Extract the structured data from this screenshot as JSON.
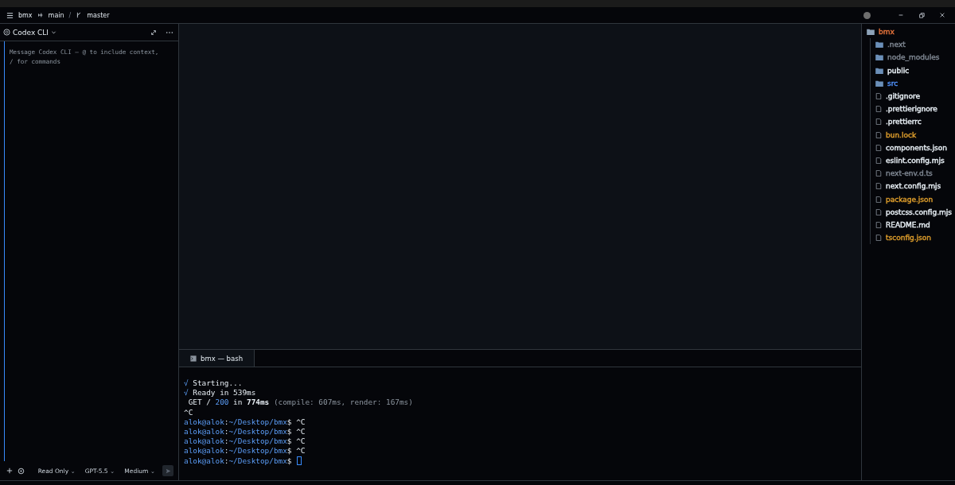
{
  "titlebar": {
    "project": "bmx",
    "branch": "main",
    "separator": "/",
    "vcs_branch": "master"
  },
  "agent_panel": {
    "title": "Codex CLI",
    "placeholder": "Message Codex CLI — @ to include context,\n/ for commands",
    "dropdowns": [
      {
        "label": "Read Only",
        "caret": "⌄"
      },
      {
        "label": "GPT-5.5",
        "caret": "⌄"
      },
      {
        "label": "Medium",
        "caret": "⌄"
      }
    ]
  },
  "terminal": {
    "tab": "bmx — bash",
    "lines": [
      {
        "kind": "status",
        "mark": "√",
        "text": "Starting..."
      },
      {
        "kind": "status",
        "mark": "√",
        "text": "Ready in 539ms"
      },
      {
        "kind": "request",
        "method": "GET /",
        "code": "200",
        "word": "in",
        "duration": "774ms",
        "detail": "(compile: 607ms, render: 167ms)"
      },
      {
        "kind": "plain",
        "text": "^C"
      },
      {
        "kind": "prompt",
        "user": "alok@alok",
        "separator": ":",
        "path": "~/Desktop/bmx",
        "sign": "$",
        "command": "^C",
        "cursor": false
      },
      {
        "kind": "prompt",
        "user": "alok@alok",
        "separator": ":",
        "path": "~/Desktop/bmx",
        "sign": "$",
        "command": "^C",
        "cursor": false
      },
      {
        "kind": "prompt",
        "user": "alok@alok",
        "separator": ":",
        "path": "~/Desktop/bmx",
        "sign": "$",
        "command": "^C",
        "cursor": false
      },
      {
        "kind": "prompt",
        "user": "alok@alok",
        "separator": ":",
        "path": "~/Desktop/bmx",
        "sign": "$",
        "command": "^C",
        "cursor": false
      },
      {
        "kind": "prompt",
        "user": "alok@alok",
        "separator": ":",
        "path": "~/Desktop/bmx",
        "sign": "$",
        "cursor": true
      }
    ]
  },
  "explorer": {
    "root": {
      "name": "bmx",
      "kind": "folder",
      "color": "#e0703a",
      "children": [
        {
          "name": ".next",
          "kind": "folder",
          "color": "#7d8590"
        },
        {
          "name": "node_modules",
          "kind": "folder",
          "color": "#7d8590"
        },
        {
          "name": "public",
          "kind": "folder",
          "color": "#e6edf3"
        },
        {
          "name": "src",
          "kind": "folder",
          "color": "#4f8ff7"
        },
        {
          "name": ".gitignore",
          "kind": "file",
          "color": "#e6edf3"
        },
        {
          "name": ".prettierignore",
          "kind": "file",
          "color": "#e6edf3"
        },
        {
          "name": ".prettierrc",
          "kind": "file",
          "color": "#e6edf3"
        },
        {
          "name": "bun.lock",
          "kind": "file",
          "color": "#d99a2b"
        },
        {
          "name": "components.json",
          "kind": "file",
          "color": "#e6edf3"
        },
        {
          "name": "eslint.config.mjs",
          "kind": "file",
          "color": "#e6edf3"
        },
        {
          "name": "next-env.d.ts",
          "kind": "file",
          "color": "#7d8590"
        },
        {
          "name": "next.config.mjs",
          "kind": "file",
          "color": "#e6edf3"
        },
        {
          "name": "package.json",
          "kind": "file",
          "color": "#d99a2b"
        },
        {
          "name": "postcss.config.mjs",
          "kind": "file",
          "color": "#e6edf3"
        },
        {
          "name": "README.md",
          "kind": "file",
          "color": "#e6edf3"
        },
        {
          "name": "tsconfig.json",
          "kind": "file",
          "color": "#d99a2b"
        }
      ]
    }
  }
}
